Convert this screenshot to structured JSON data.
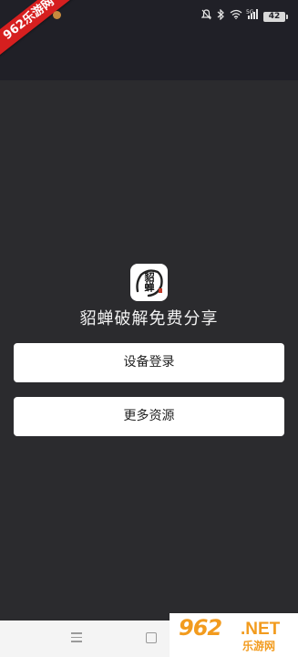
{
  "watermark": {
    "corner_badge": "962乐游网",
    "bottom_number": "962",
    "bottom_net": ".NET",
    "bottom_sub": "乐游网"
  },
  "status_bar": {
    "network_label": "5G",
    "battery_level": "42"
  },
  "app": {
    "logo_text": "貂蝉",
    "title": "貂蝉破解免费分享"
  },
  "buttons": {
    "login_label": "设备登录",
    "more_label": "更多资源"
  },
  "icons": {
    "mute": "mute-icon",
    "bluetooth": "bluetooth-icon",
    "wifi": "wifi-icon",
    "signal": "signal-icon",
    "battery": "battery-icon",
    "menu": "menu-icon",
    "home": "home-icon"
  }
}
